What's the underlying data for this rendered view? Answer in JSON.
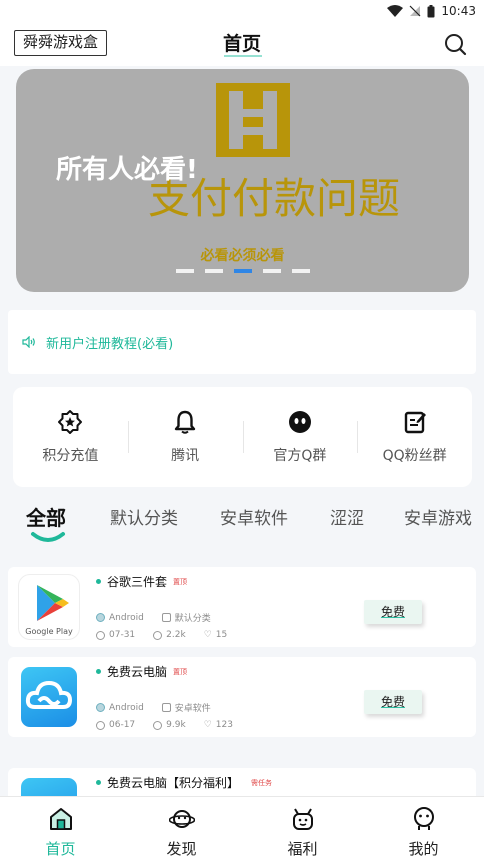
{
  "status_bar": {
    "time": "10:43"
  },
  "header": {
    "app_badge": "舜舜游戏盒",
    "title": "首页",
    "search_icon": "search-icon"
  },
  "banner": {
    "headline": "所有人必看!",
    "subtitle": "支付付款问题",
    "caption": "必看必须必看",
    "slide_count": 5,
    "active_slide": 3,
    "accent_color": "#b8950a"
  },
  "notice": {
    "icon": "speaker-icon",
    "text": "新用户注册教程(必看)"
  },
  "quick_actions": [
    {
      "icon": "star-badge-icon",
      "label": "积分充值"
    },
    {
      "icon": "bell-icon",
      "label": "腾讯"
    },
    {
      "icon": "qq-icon",
      "label": "官方Q群"
    },
    {
      "icon": "edit-note-icon",
      "label": "QQ粉丝群"
    }
  ],
  "category_tabs": {
    "items": [
      "全部",
      "默认分类",
      "安卓软件",
      "涩涩",
      "安卓游戏"
    ],
    "active_index": 0
  },
  "games": [
    {
      "title": "谷歌三件套",
      "tag": "置顶",
      "platform": "Android",
      "category": "默认分类",
      "date": "07-31",
      "downloads": "2.2k",
      "likes": "15",
      "action": "免费",
      "icon": "google-play-icon"
    },
    {
      "title": "免费云电脑",
      "tag": "置顶",
      "platform": "Android",
      "category": "安卓软件",
      "date": "06-17",
      "downloads": "9.9k",
      "likes": "123",
      "action": "免费",
      "icon": "cloud-icon"
    },
    {
      "title": "免费云电脑【积分福利】",
      "tag": "需任务",
      "icon": "cloud-icon"
    }
  ],
  "bottom_nav": {
    "items": [
      {
        "icon": "home-icon",
        "label": "首页"
      },
      {
        "icon": "planet-icon",
        "label": "发现"
      },
      {
        "icon": "gift-character-icon",
        "label": "福利"
      },
      {
        "icon": "profile-face-icon",
        "label": "我的"
      }
    ],
    "active_index": 0,
    "accent_color": "#1fb89a"
  }
}
